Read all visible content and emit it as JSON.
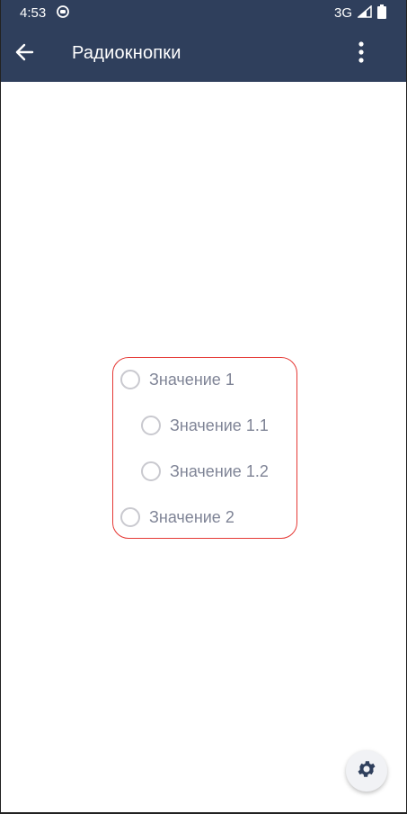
{
  "status_bar": {
    "time": "4:53",
    "network": "3G",
    "icons": [
      "notification-icon",
      "signal-icon",
      "battery-icon"
    ]
  },
  "app_bar": {
    "title": "Радиокнопки",
    "back_icon": "arrow-left-icon",
    "menu_icon": "more-vert-icon"
  },
  "radio_group": {
    "items": [
      {
        "label": "Значение 1",
        "checked": false
      },
      {
        "label": "Значение 1.1",
        "checked": false
      },
      {
        "label": "Значение 1.2",
        "checked": false
      },
      {
        "label": "Значение 2",
        "checked": false
      }
    ]
  },
  "fab": {
    "icon": "gear-icon"
  },
  "colors": {
    "app_bar": "#2f3f5c",
    "group_border": "#e53935",
    "radio_label": "#7f8496",
    "radio_border": "#c9c9cf"
  }
}
